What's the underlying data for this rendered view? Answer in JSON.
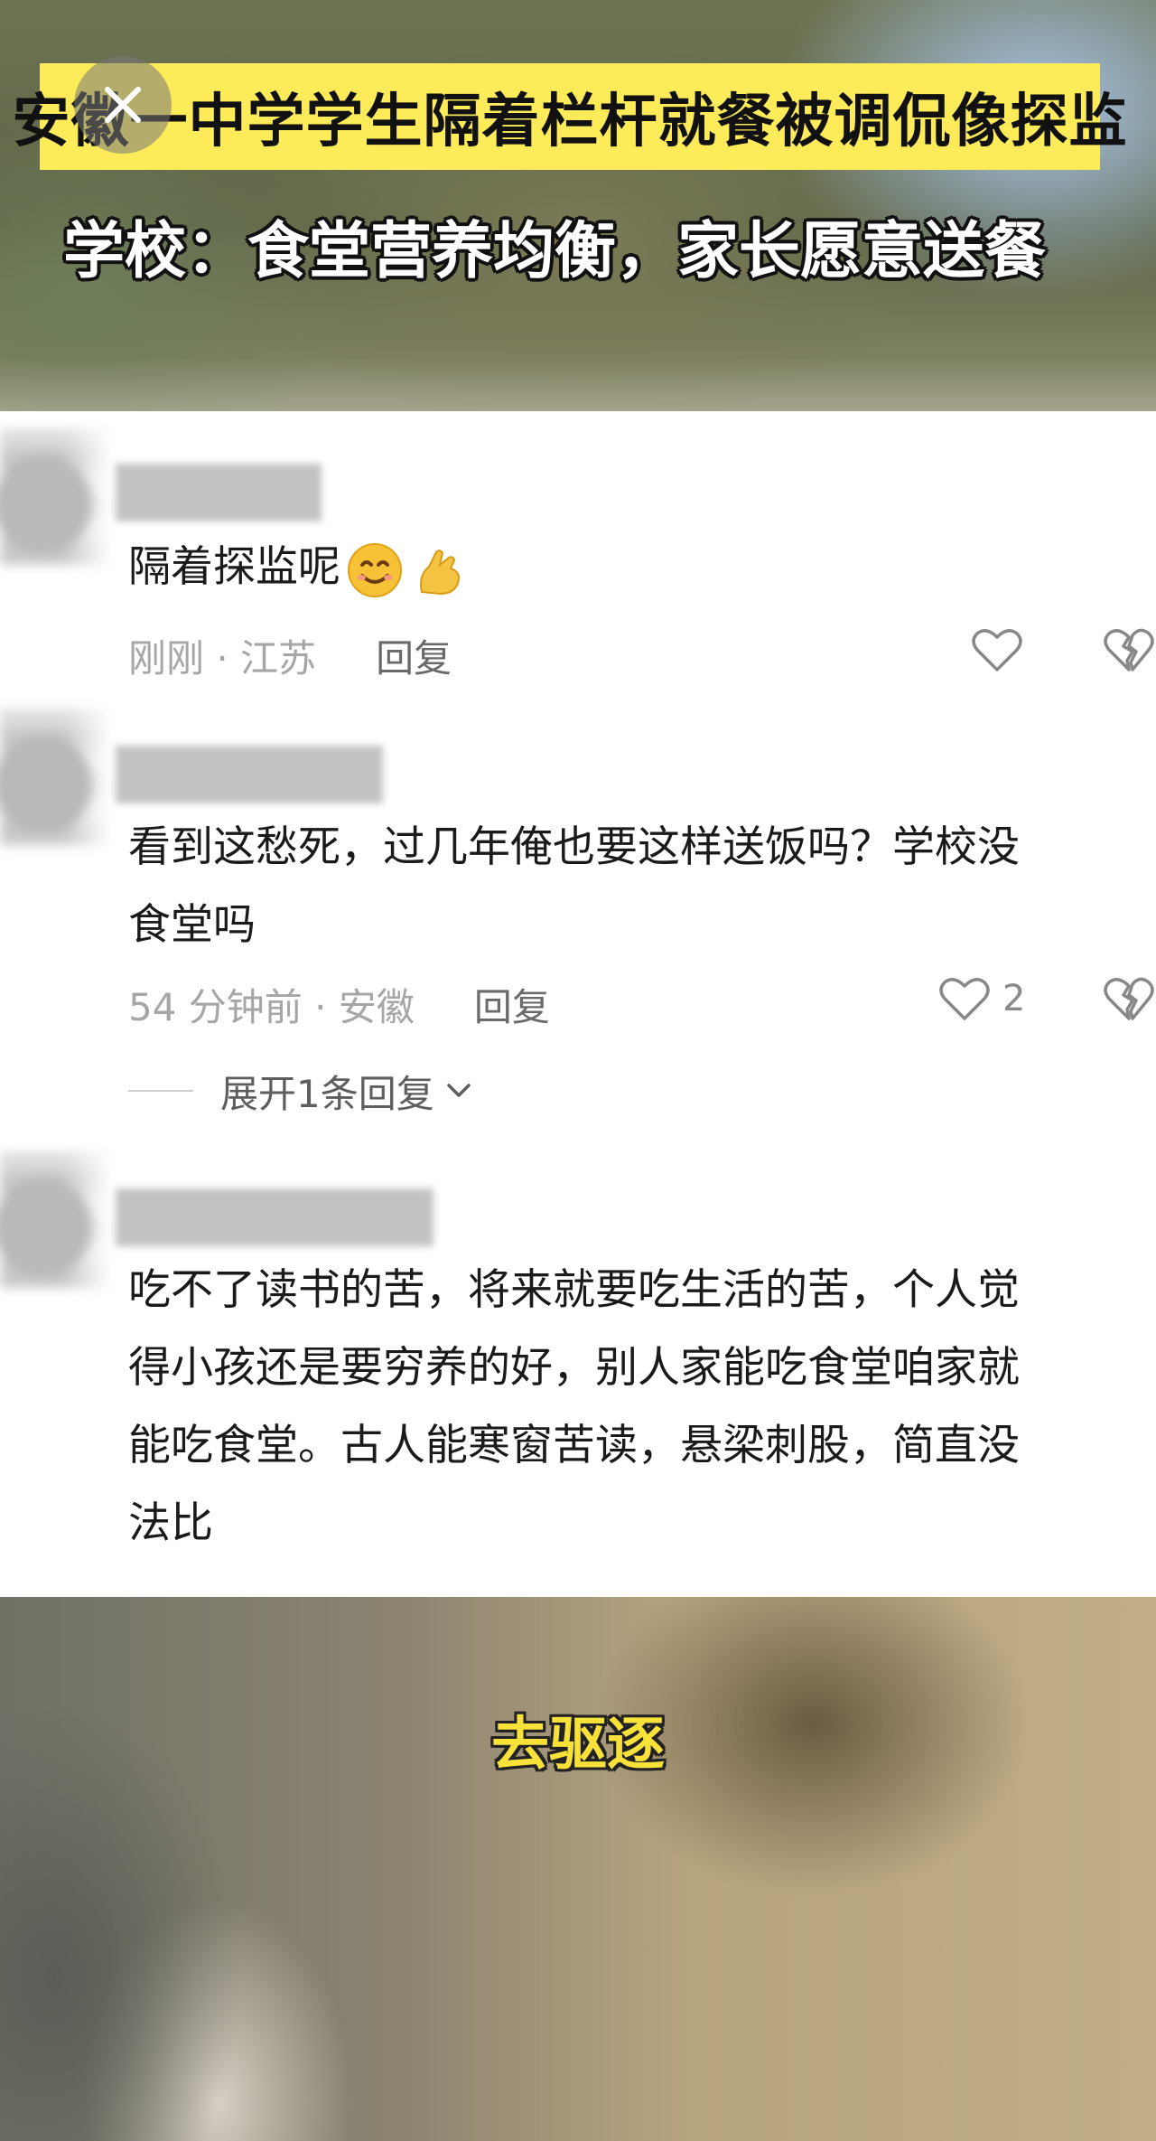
{
  "top_video": {
    "headline": "安徽一中学学生隔着栏杆就餐被调侃像探监",
    "subheadline": "学校：食堂营养均衡，家长愿意送餐",
    "close_icon": "close-icon"
  },
  "comments": [
    {
      "text": "隔着探监呢",
      "emojis": [
        "smiling-face-icon",
        "pinched-fingers-icon"
      ],
      "time_location": "刚刚 · 江苏",
      "reply_label": "回复",
      "like_count": "",
      "like_icon": "heart-icon",
      "dislike_icon": "broken-heart-icon"
    },
    {
      "text_line1": "看到这愁死，过几年俺也要这样送饭吗？学校没",
      "text_line2": "食堂吗",
      "time_location": "54 分钟前 · 安徽",
      "reply_label": "回复",
      "like_count": "2",
      "like_icon": "heart-icon",
      "dislike_icon": "broken-heart-icon",
      "expand_label": "展开1条回复",
      "expand_icon": "chevron-down-icon"
    },
    {
      "text_line1": "吃不了读书的苦，将来就要吃生活的苦，个人觉",
      "text_line2": "得小孩还是要穷养的好，别人家能吃食堂咱家就",
      "text_line3": "能吃食堂。古人能寒窗苦读，悬梁刺股，简直没",
      "text_line4": "法比"
    }
  ],
  "bottom_video": {
    "caption": "去驱逐"
  },
  "colors": {
    "headline_bg": "#fdeb5a",
    "caption_text": "#f8e23a",
    "meta_text": "#a6a6a6",
    "body_text": "#1a1a1a"
  }
}
